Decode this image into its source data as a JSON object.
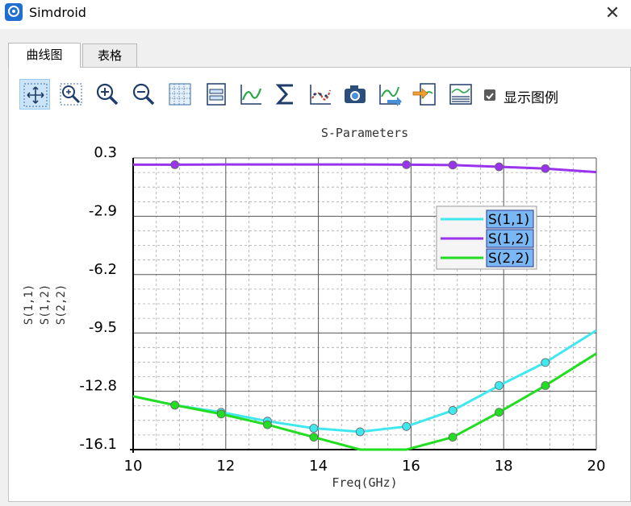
{
  "window": {
    "title": "Simdroid",
    "close_icon": "close-icon"
  },
  "tabs": [
    {
      "label": "曲线图",
      "active": true
    },
    {
      "label": "表格",
      "active": false
    }
  ],
  "toolbar": {
    "tools": [
      "pan-icon",
      "zoom-box-icon",
      "zoom-in-icon",
      "zoom-out-icon",
      "grid-icon",
      "axis-settings-icon",
      "curve-style-icon",
      "sum-icon",
      "curve-fit-icon",
      "screenshot-icon",
      "export-curve-icon",
      "import-curve-icon",
      "data-table-icon"
    ],
    "show_legend_label": "显示图例",
    "show_legend_checked": true
  },
  "colors": {
    "s11": "#3fe8ee",
    "s12": "#9933ee",
    "s22": "#22dd22",
    "legend_highlight": "#7ab8f5"
  },
  "chart_data": {
    "type": "line",
    "title": "S-Parameters",
    "xlabel": "Freq(GHz)",
    "ylabels": [
      "S(1,1)",
      "S(1,2)",
      "S(2,2)"
    ],
    "xlim": [
      10,
      20
    ],
    "ylim": [
      -16.1,
      0.3
    ],
    "xticks": [
      "10",
      "12",
      "14",
      "16",
      "18",
      "20"
    ],
    "yticks": [
      "0.3",
      "-2.9",
      "-6.2",
      "-9.5",
      "-12.8",
      "-16.1"
    ],
    "grid": true,
    "legend_position": "right",
    "series": [
      {
        "name": "S(1,1)",
        "x": [
          10,
          10.9,
          11.9,
          12.9,
          13.9,
          14.9,
          15.9,
          16.9,
          17.9,
          18.9,
          20
        ],
        "y": [
          -13.1,
          -13.6,
          -14.0,
          -14.5,
          -14.9,
          -15.1,
          -14.8,
          -13.9,
          -12.5,
          -11.2,
          -9.4
        ],
        "markers": [
          10.9,
          11.9,
          12.9,
          13.9,
          14.9,
          15.9,
          16.9,
          17.9,
          18.9
        ]
      },
      {
        "name": "S(1,2)",
        "x": [
          10,
          10.9,
          11.9,
          12.9,
          13.9,
          14.9,
          15.9,
          16.9,
          17.9,
          18.9,
          20
        ],
        "y": [
          -0.08,
          -0.08,
          -0.07,
          -0.07,
          -0.07,
          -0.07,
          -0.08,
          -0.1,
          -0.2,
          -0.3,
          -0.5
        ],
        "markers": [
          10.9,
          15.9,
          16.9,
          17.9,
          18.9
        ]
      },
      {
        "name": "S(2,2)",
        "x": [
          10,
          10.9,
          11.9,
          12.9,
          13.9,
          14.9,
          15.9,
          16.9,
          17.9,
          18.9,
          20
        ],
        "y": [
          -13.1,
          -13.6,
          -14.1,
          -14.7,
          -15.4,
          -16.1,
          -16.1,
          -15.4,
          -14.0,
          -12.5,
          -10.7
        ],
        "markers": [
          10.9,
          11.9,
          12.9,
          13.9,
          16.9,
          17.9,
          18.9
        ]
      }
    ]
  }
}
